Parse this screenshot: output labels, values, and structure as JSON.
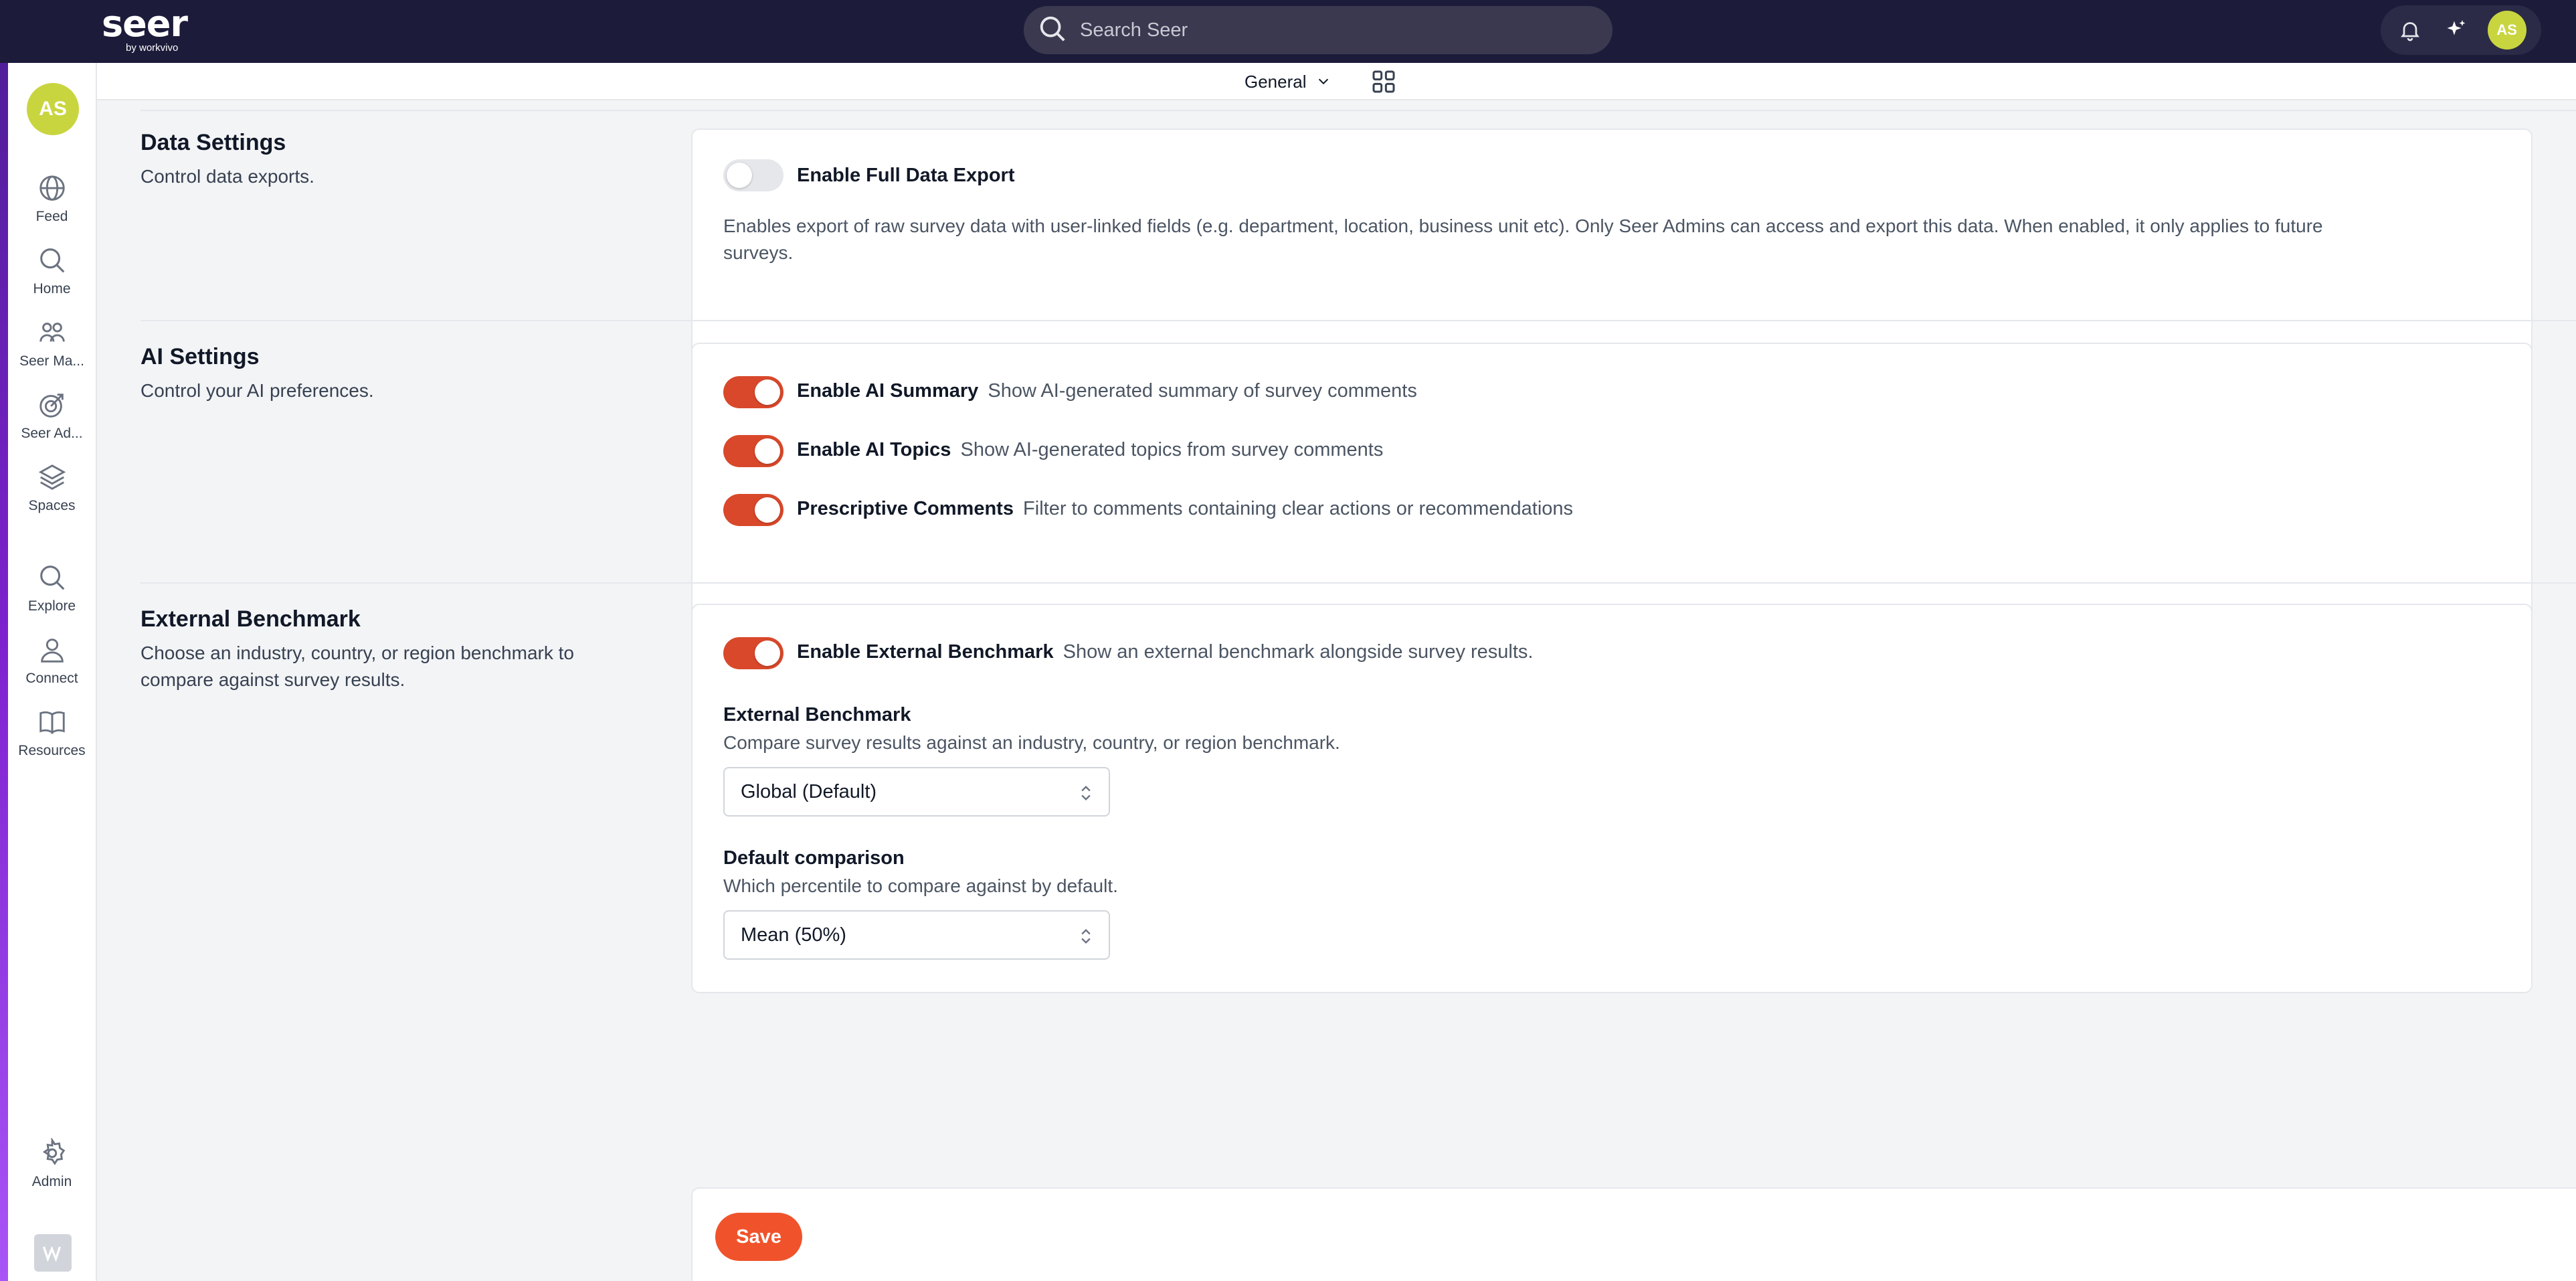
{
  "topbar": {
    "logo": "seer",
    "logo_sub": "by workvivo",
    "search_placeholder": "Search Seer",
    "avatar_initials": "AS"
  },
  "subheader": {
    "view_label": "General"
  },
  "sidebar": {
    "avatar_initials": "AS",
    "items": [
      {
        "label": "Feed",
        "icon": "globe-icon"
      },
      {
        "label": "Home",
        "icon": "search-icon"
      },
      {
        "label": "Seer Ma...",
        "icon": "people-icon"
      },
      {
        "label": "Seer Ad...",
        "icon": "target-icon"
      },
      {
        "label": "Spaces",
        "icon": "layers-icon"
      },
      {
        "label": "Explore",
        "icon": "search-icon"
      },
      {
        "label": "Connect",
        "icon": "person-icon"
      },
      {
        "label": "Resources",
        "icon": "book-icon"
      },
      {
        "label": "Admin",
        "icon": "gear-icon"
      }
    ]
  },
  "data_settings": {
    "title": "Data Settings",
    "description": "Control data exports.",
    "full_export": {
      "label": "Enable Full Data Export",
      "enabled": false,
      "help_line1": "Enables export of raw survey data with user-linked fields (e.g. department, location, business unit etc). Only Seer Admins can access and export this data. When enabled, it only applies to future",
      "help_line2": "surveys."
    }
  },
  "ai_settings": {
    "title": "AI Settings",
    "description": "Control your AI preferences.",
    "options": [
      {
        "label": "Enable AI Summary",
        "desc": "Show AI-generated summary of survey comments",
        "enabled": true
      },
      {
        "label": "Enable AI Topics",
        "desc": "Show AI-generated topics from survey comments",
        "enabled": true
      },
      {
        "label": "Prescriptive Comments",
        "desc": "Filter to comments containing clear actions or recommendations",
        "enabled": true
      }
    ]
  },
  "external_benchmark": {
    "title": "External Benchmark",
    "description_line1": "Choose an industry, country, or region benchmark to",
    "description_line2": "compare against survey results.",
    "toggle": {
      "label": "Enable External Benchmark",
      "desc": "Show an external benchmark alongside survey results.",
      "enabled": true
    },
    "benchmark_field": {
      "label": "External Benchmark",
      "help": "Compare survey results against an industry, country, or region benchmark.",
      "value": "Global (Default)"
    },
    "comparison_field": {
      "label": "Default comparison",
      "help": "Which percentile to compare against by default.",
      "value": "Mean (50%)"
    }
  },
  "footer": {
    "save_label": "Save"
  },
  "colors": {
    "topbar": "#1c1b3a",
    "toggle_on": "#d9482b",
    "save_button": "#f0532b",
    "avatar": "#c9d53f"
  }
}
